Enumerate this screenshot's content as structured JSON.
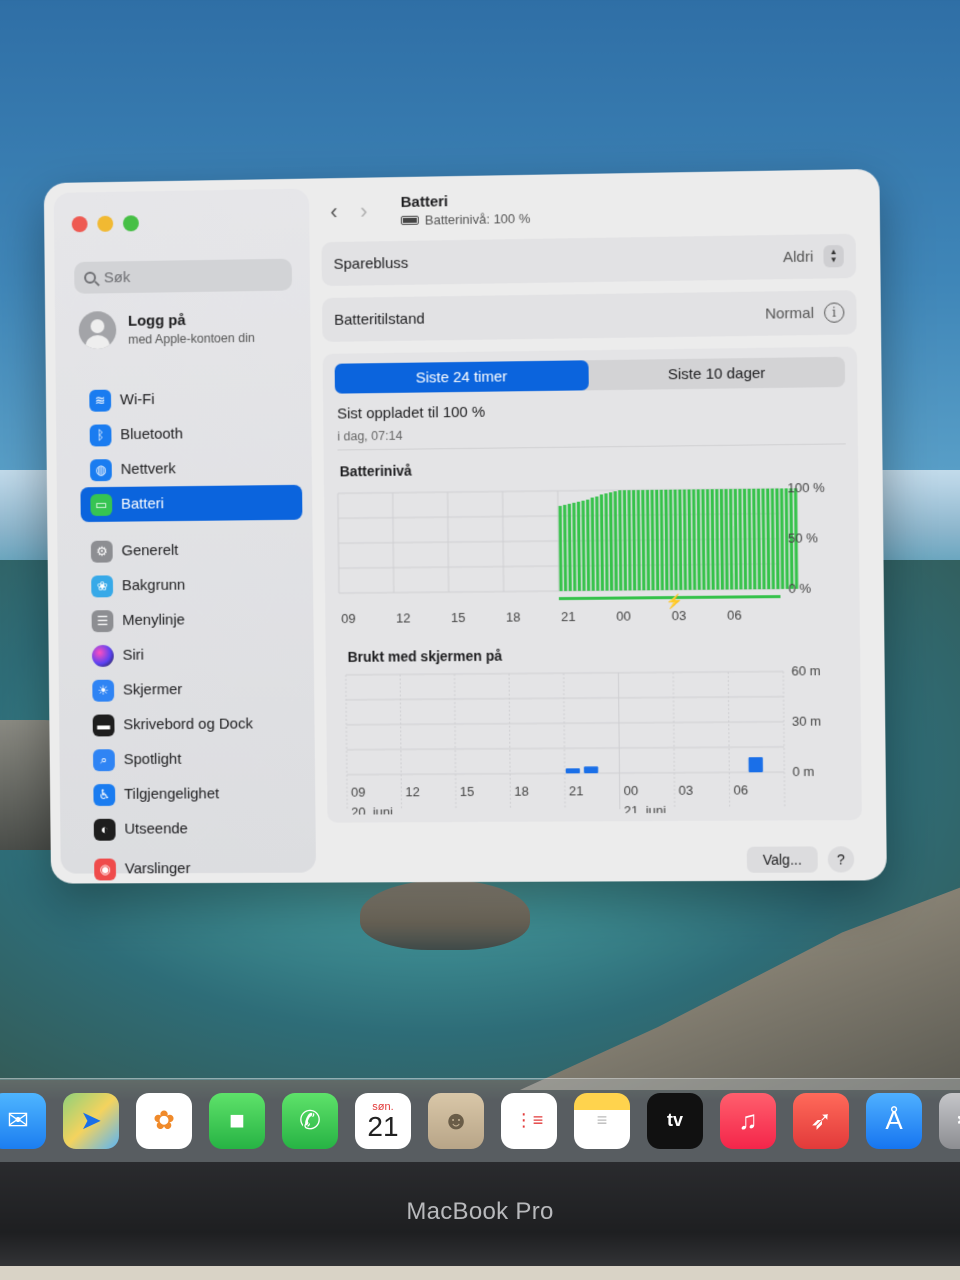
{
  "window": {
    "title": "Batteri",
    "subtitle": "Batterinivå: 100 %"
  },
  "sidebar": {
    "search_placeholder": "Søk",
    "account": {
      "title": "Logg på",
      "subtitle": "med Apple-kontoen din"
    },
    "items": [
      {
        "label": "Wi-Fi",
        "icon": "wifi-icon",
        "color": "#1a7cf0"
      },
      {
        "label": "Bluetooth",
        "icon": "bluetooth-icon",
        "color": "#1a7cf0"
      },
      {
        "label": "Nettverk",
        "icon": "globe-icon",
        "color": "#1a7cf0"
      },
      {
        "label": "Batteri",
        "icon": "battery-icon",
        "color": "#36c452",
        "selected": true
      },
      {
        "label": "Generelt",
        "icon": "gear-icon",
        "color": "#8d8e92"
      },
      {
        "label": "Bakgrunn",
        "icon": "flower-icon",
        "color": "#37a9e8"
      },
      {
        "label": "Menylinje",
        "icon": "menubar-icon",
        "color": "#1e1e1e"
      },
      {
        "label": "Siri",
        "icon": "siri-icon",
        "color": "#5a42f2"
      },
      {
        "label": "Skjermer",
        "icon": "sun-icon",
        "color": "#2f84f4"
      },
      {
        "label": "Skrivebord og Dock",
        "icon": "dock-icon",
        "color": "#1e1e1e"
      },
      {
        "label": "Spotlight",
        "icon": "magnifier-icon",
        "color": "#2f84f4"
      },
      {
        "label": "Tilgjengelighet",
        "icon": "accessibility-icon",
        "color": "#1a7cf0"
      },
      {
        "label": "Utseende",
        "icon": "appearance-icon",
        "color": "#1e1e1e"
      },
      {
        "label": "Varslinger",
        "icon": "bell-icon",
        "color": "#ef4b4b"
      }
    ]
  },
  "settings": {
    "low_power": {
      "label": "Sparebluss",
      "value": "Aldri"
    },
    "health": {
      "label": "Batteritilstand",
      "value": "Normal"
    }
  },
  "tabs": [
    {
      "label": "Siste 24 timer",
      "active": true
    },
    {
      "label": "Siste 10 dager",
      "active": false
    }
  ],
  "last_charged": {
    "label": "Sist oppladet til 100 %",
    "time": "i dag, 07:14"
  },
  "chart_data": [
    {
      "type": "bar",
      "title": "Batterinivå",
      "x_ticks": [
        "09",
        "12",
        "15",
        "18",
        "21",
        "00",
        "03",
        "06"
      ],
      "y_ticks": [
        "100 %",
        "50 %",
        "0 %"
      ],
      "ylim": [
        0,
        100
      ],
      "hours_window": 24,
      "start_hour_offset": 12.0,
      "interval_hours": 0.25,
      "values": [
        85,
        86,
        87,
        88,
        89,
        90,
        91,
        93,
        94,
        96,
        97,
        98,
        99,
        100,
        100,
        100,
        100,
        100,
        100,
        100,
        100,
        100,
        100,
        100,
        100,
        100,
        100,
        100,
        100,
        100,
        100,
        100,
        100,
        100,
        100,
        100,
        100,
        100,
        100,
        100,
        100,
        100,
        100,
        100,
        100,
        100,
        100,
        100,
        100,
        100,
        100,
        100
      ],
      "charging": true,
      "color": "#35c24a"
    },
    {
      "type": "bar",
      "title": "Brukt med skjermen på",
      "x_ticks": [
        "09",
        "12",
        "15",
        "18",
        "21",
        "00",
        "03",
        "06"
      ],
      "date_labels": [
        "20. juni",
        "21. juni"
      ],
      "y_ticks": [
        "60 m",
        "30 m",
        "0 m"
      ],
      "ylim": [
        0,
        60
      ],
      "bars": [
        {
          "hour": "21",
          "minutes": 3
        },
        {
          "hour": "22",
          "minutes": 4
        },
        {
          "hour": "07",
          "minutes": 9
        }
      ],
      "color": "#1a6fe8"
    }
  ],
  "footer": {
    "options_label": "Valg...",
    "help_label": "?"
  },
  "dock": {
    "apps": [
      "Mail",
      "Kart",
      "Bilder",
      "FaceTime",
      "Telefon",
      "Kalender",
      "Kontakter",
      "Påminnelser",
      "Notater",
      "TV",
      "Musikk",
      "Rocket",
      "App Store",
      "Systeminnstillinger"
    ],
    "calendar_month": "søn.",
    "calendar_day": "21",
    "tv_label": "tv"
  },
  "device_label": "MacBook Pro"
}
